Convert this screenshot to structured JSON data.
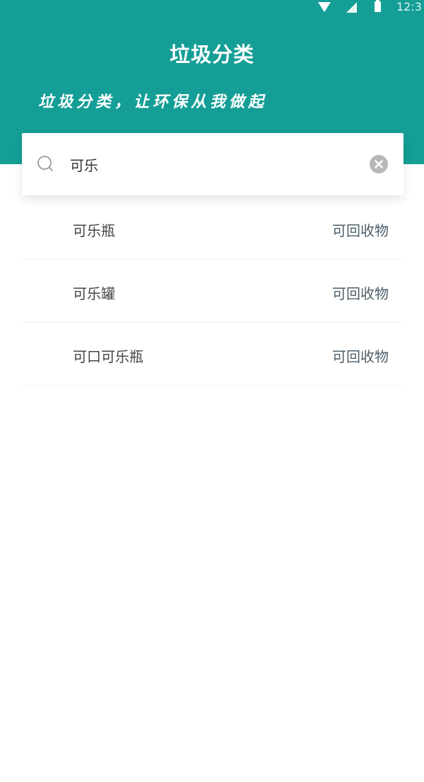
{
  "status_bar": {
    "time": "12:3"
  },
  "header": {
    "title": "垃圾分类",
    "slogan": "垃圾分类，让环保从我做起"
  },
  "search": {
    "value": "可乐",
    "icon": "search-icon",
    "clear_icon": "clear-icon"
  },
  "results": [
    {
      "name": "可乐瓶",
      "category": "可回收物"
    },
    {
      "name": "可乐罐",
      "category": "可回收物"
    },
    {
      "name": "可口可乐瓶",
      "category": "可回收物"
    }
  ],
  "colors": {
    "header_bg": "#149e96",
    "category_text": "#4e5f6a"
  }
}
